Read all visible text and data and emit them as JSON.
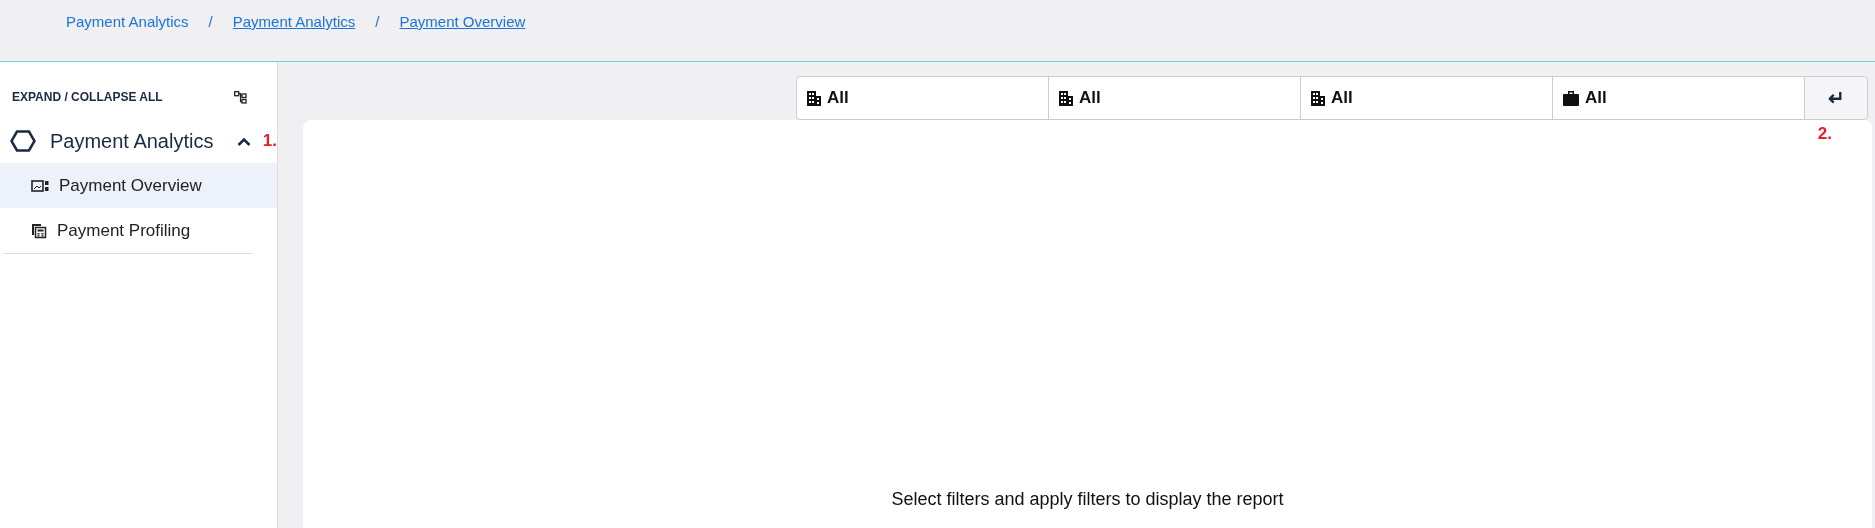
{
  "breadcrumb": [
    {
      "label": "Payment Analytics",
      "current": false
    },
    {
      "label": "Payment Analytics",
      "current": true
    },
    {
      "label": "Payment Overview",
      "current": true
    }
  ],
  "breadcrumb_separator": "/",
  "sidebar": {
    "expand_collapse_label": "EXPAND / COLLAPSE ALL",
    "groups": [
      {
        "label": "Payment Analytics",
        "expanded": true,
        "annotation": "1.",
        "children": [
          {
            "label": "Payment Overview",
            "kind": "overview",
            "selected": true
          },
          {
            "label": "Payment Profiling",
            "kind": "profiling",
            "selected": false
          }
        ]
      }
    ]
  },
  "filters": [
    {
      "value": "All",
      "kind": "building"
    },
    {
      "value": "All",
      "kind": "building"
    },
    {
      "value": "All",
      "kind": "building"
    },
    {
      "value": "All",
      "kind": "briefcase"
    }
  ],
  "apply_button": {
    "symbol": "↵",
    "annotation": "2."
  },
  "report": {
    "message": "Select filters and apply filters to display the report"
  }
}
